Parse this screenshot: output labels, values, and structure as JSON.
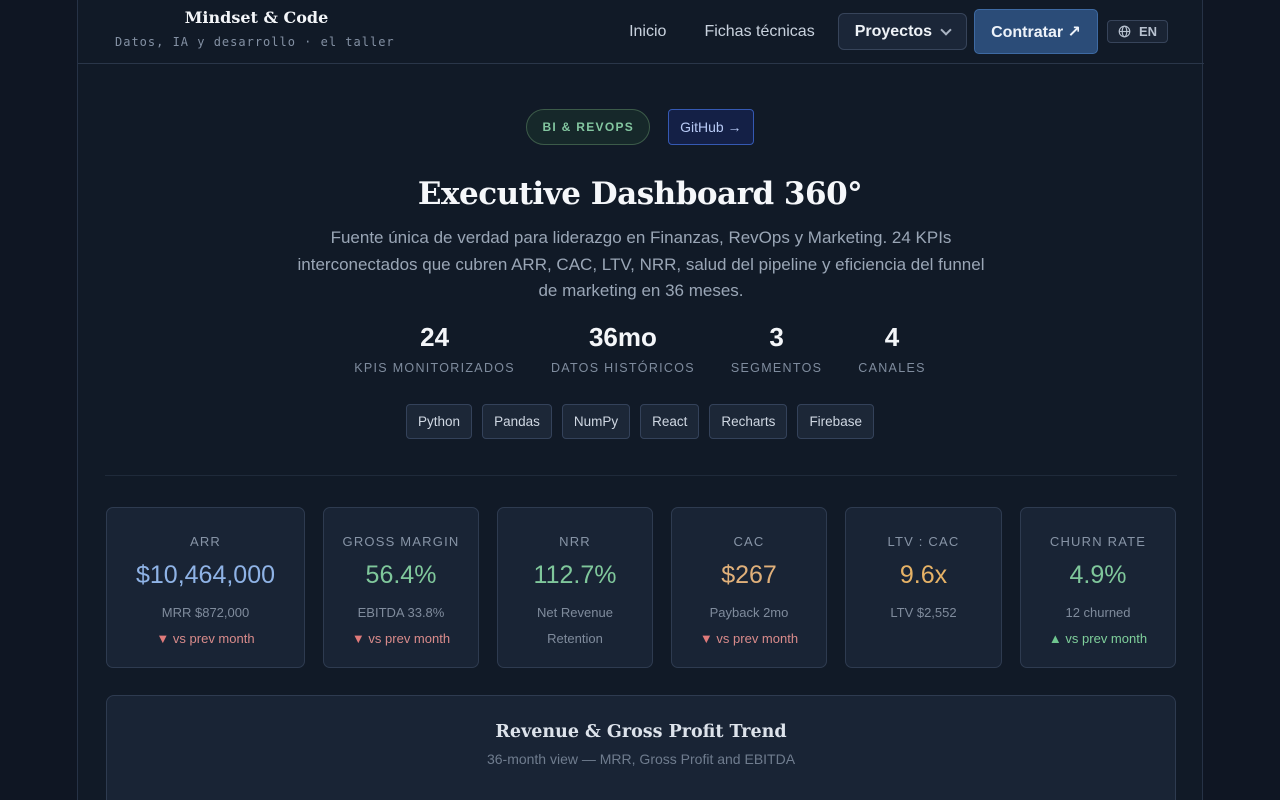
{
  "brand": {
    "title": "Mindset & Code",
    "subtitle": "Datos, IA y desarrollo · el taller"
  },
  "nav": {
    "links": [
      "Inicio",
      "Fichas técnicas"
    ],
    "projects_label": "Proyectos",
    "hire_label": "Contratar ↗",
    "lang_label": "EN",
    "lang_icon": "globe-icon"
  },
  "hero": {
    "badge": "BI & REVOPS",
    "github": "GitHub →",
    "title": "Executive Dashboard 360°",
    "description": "Fuente única de verdad para liderazgo en Finanzas, RevOps y Marketing. 24 KPIs interconectados que cubren ARR, CAC, LTV, NRR, salud del pipeline y eficiencia del funnel de marketing en 36 meses."
  },
  "stats": [
    {
      "value": "24",
      "label": "KPIS MONITORIZADOS"
    },
    {
      "value": "36mo",
      "label": "DATOS HISTÓRICOS"
    },
    {
      "value": "3",
      "label": "SEGMENTOS"
    },
    {
      "value": "4",
      "label": "CANALES"
    }
  ],
  "techs": [
    "Python",
    "Pandas",
    "NumPy",
    "React",
    "Recharts",
    "Firebase"
  ],
  "kpis": [
    {
      "label": "ARR",
      "value": "$10,464,000",
      "color": "#8fb3e6",
      "sub": "MRR $872,000",
      "delta": "vs prev month",
      "dir": "down"
    },
    {
      "label": "GROSS MARGIN",
      "value": "56.4%",
      "color": "#7fc79b",
      "sub": "EBITDA 33.8%",
      "delta": "vs prev month",
      "dir": "down"
    },
    {
      "label": "NRR",
      "value": "112.7%",
      "color": "#7fc79b",
      "sub": "Net Revenue",
      "sub2": "Retention",
      "delta": "",
      "dir": ""
    },
    {
      "label": "CAC",
      "value": "$267",
      "color": "#e0b07a",
      "sub": "Payback 2mo",
      "delta": "vs prev month",
      "dir": "down"
    },
    {
      "label": "LTV : CAC",
      "value": "9.6x",
      "color": "#e6b266",
      "sub": "LTV $2,552",
      "delta": "",
      "dir": ""
    },
    {
      "label": "CHURN RATE",
      "value": "4.9%",
      "color": "#7fc79b",
      "sub": "12 churned",
      "delta": "vs prev month",
      "dir": "up"
    }
  ],
  "panel": {
    "title": "Revenue & Gross Profit Trend",
    "subtitle": "36-month view — MRR, Gross Profit and EBITDA"
  }
}
